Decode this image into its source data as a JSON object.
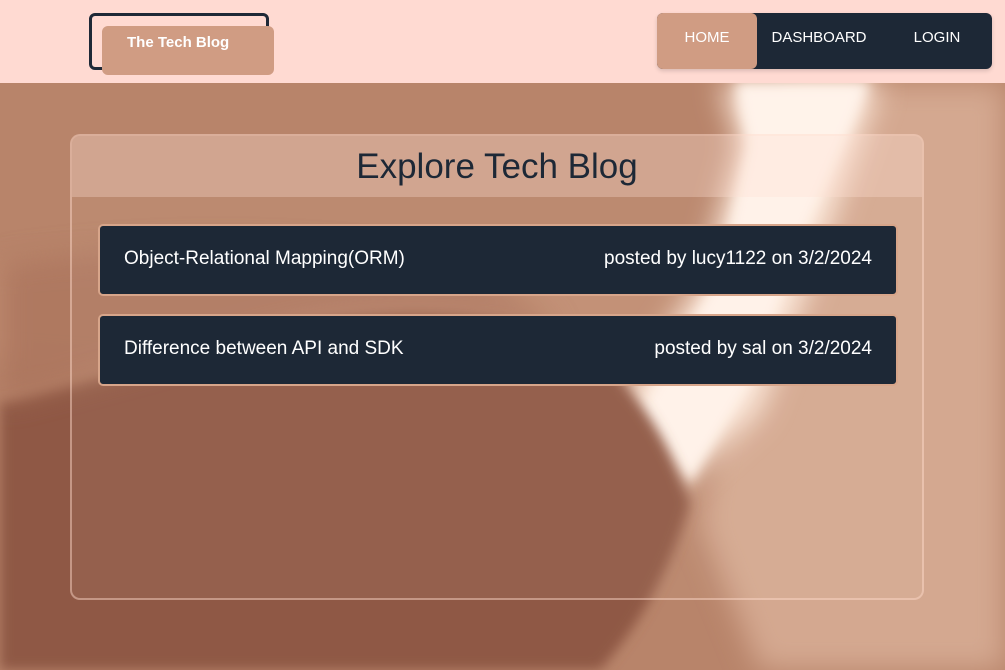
{
  "header": {
    "logo_text": "The Tech Blog",
    "nav": [
      {
        "label": "HOME",
        "active": true
      },
      {
        "label": "DASHBOARD",
        "active": false
      },
      {
        "label": "LOGIN",
        "active": false
      }
    ]
  },
  "main": {
    "title": "Explore Tech Blog",
    "posts": [
      {
        "title": "Object-Relational Mapping(ORM)",
        "meta": "posted by lucy1122 on 3/2/2024"
      },
      {
        "title": "Difference between API and SDK",
        "meta": "posted by sal on 3/2/2024"
      }
    ]
  },
  "colors": {
    "header_bg": "#ffdad2",
    "dark": "#1d2836",
    "accent": "#d09c83"
  }
}
